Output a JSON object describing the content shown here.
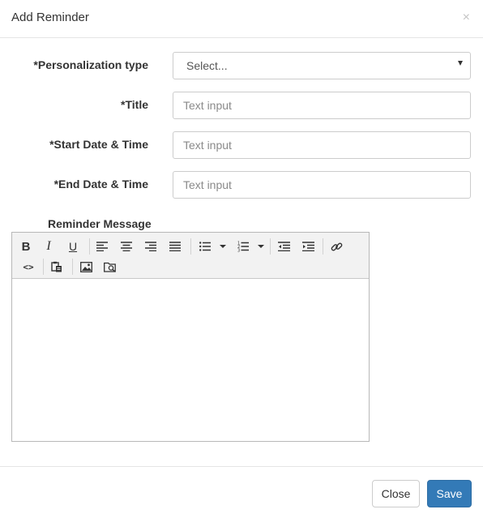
{
  "dialog": {
    "title": "Add Reminder",
    "close_symbol": "×"
  },
  "form": {
    "personalization": {
      "label": "*Personalization type",
      "value": "Select..."
    },
    "title": {
      "label": "*Title",
      "placeholder": "Text input"
    },
    "start": {
      "label": "*Start Date & Time",
      "placeholder": "Text input"
    },
    "end": {
      "label": "*End Date & Time",
      "placeholder": "Text input"
    },
    "message": {
      "label": "Reminder Message"
    }
  },
  "toolbar": {
    "bold": "B",
    "italic": "I",
    "underline": "U",
    "code": "<>",
    "icons": [
      "bold-icon",
      "italic-icon",
      "underline-icon",
      "align-left-icon",
      "align-center-icon",
      "align-right-icon",
      "align-justify-icon",
      "bullet-list-icon",
      "numbered-list-icon",
      "outdent-icon",
      "indent-icon",
      "link-icon",
      "code-view-icon",
      "paste-icon",
      "image-icon",
      "file-browser-icon"
    ]
  },
  "footer": {
    "close_label": "Close",
    "save_label": "Save"
  },
  "colors": {
    "primary": "#337ab7",
    "border": "#cccccc",
    "toolbar_bg": "#f2f2f2"
  }
}
